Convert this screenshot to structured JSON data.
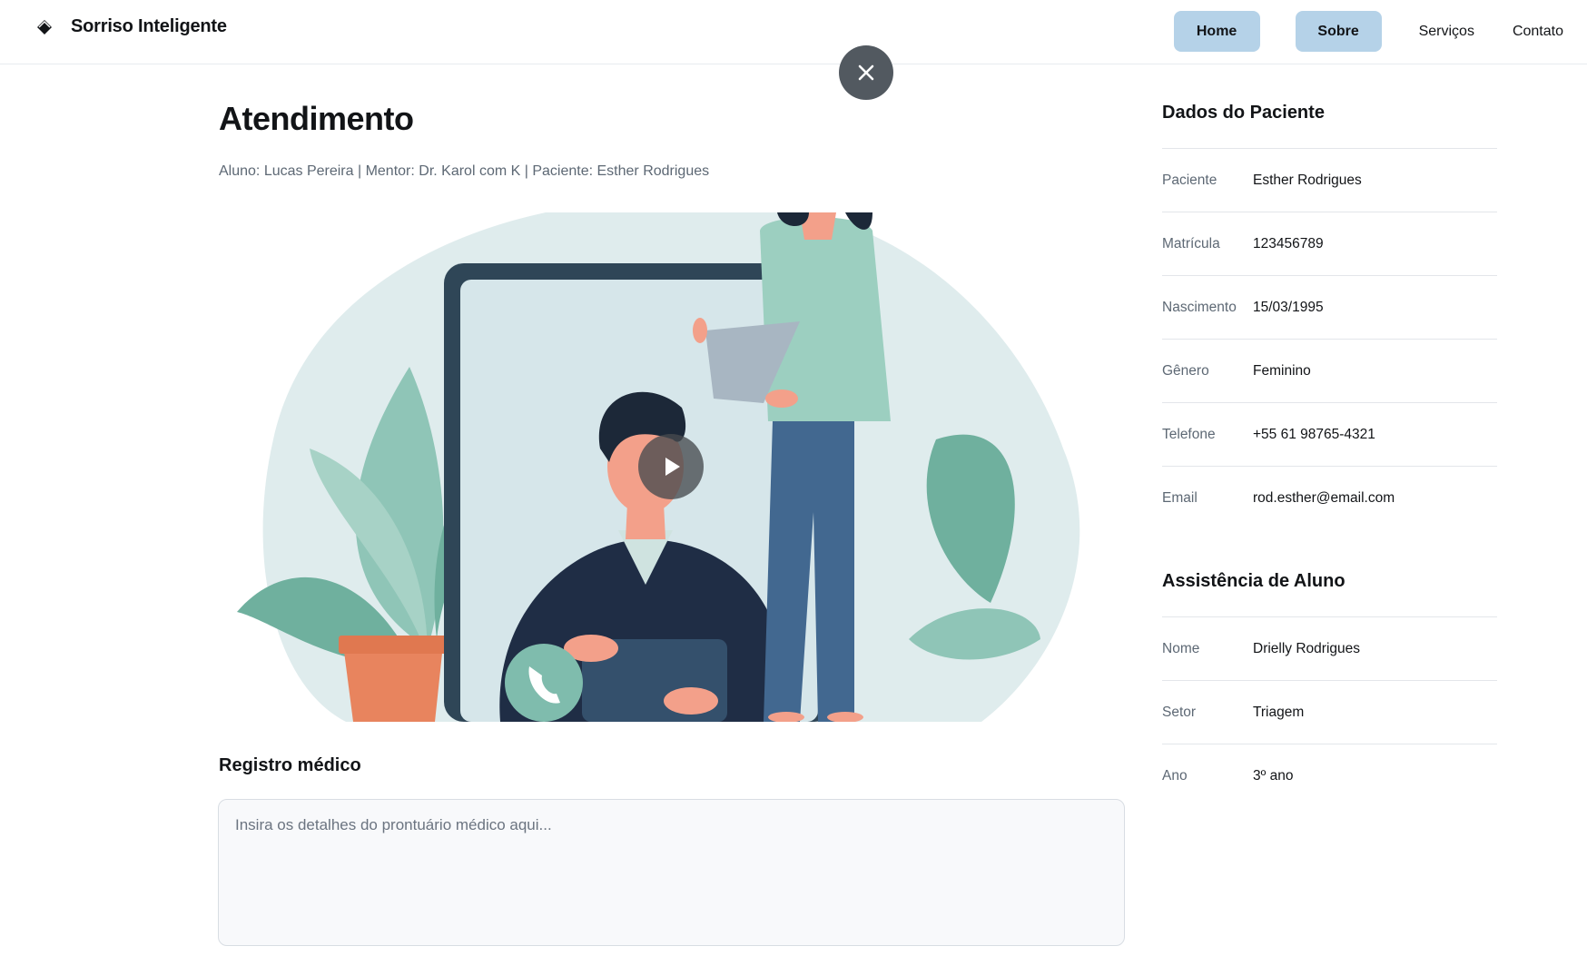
{
  "header": {
    "brand": "Sorriso Inteligente",
    "nav": [
      {
        "label": "Home",
        "active": true
      },
      {
        "label": "Sobre",
        "active": true
      },
      {
        "label": "Serviços",
        "active": false
      },
      {
        "label": "Contato",
        "active": false
      }
    ]
  },
  "main": {
    "title": "Atendimento",
    "subtitle": "Aluno: Lucas Pereira | Mentor: Dr. Karol com K | Paciente: Esther Rodrigues",
    "record_title": "Registro médico",
    "record_placeholder": "Insira os detalhes do prontuário médico aqui..."
  },
  "patient": {
    "title": "Dados do Paciente",
    "fields": [
      {
        "label": "Paciente",
        "value": "Esther Rodrigues"
      },
      {
        "label": "Matrícula",
        "value": "123456789"
      },
      {
        "label": "Nascimento",
        "value": "15/03/1995"
      },
      {
        "label": "Gênero",
        "value": "Feminino"
      },
      {
        "label": "Telefone",
        "value": "+55 61 98765-4321"
      },
      {
        "label": "Email",
        "value": "rod.esther@email.com"
      }
    ]
  },
  "assistant": {
    "title": "Assistência de Aluno",
    "fields": [
      {
        "label": "Nome",
        "value": "Drielly Rodrigues"
      },
      {
        "label": "Setor",
        "value": "Triagem"
      },
      {
        "label": "Ano",
        "value": "3º ano"
      }
    ]
  },
  "colors": {
    "nav_active_bg": "#b5d2e8",
    "close_btn": "#525960",
    "muted_text": "#5d6874"
  }
}
